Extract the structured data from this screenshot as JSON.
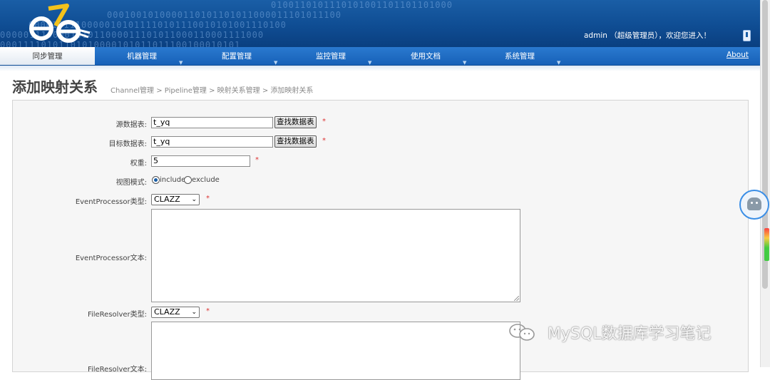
{
  "header": {
    "user_text": "admin （超级管理员），欢迎您进入！"
  },
  "nav": {
    "items": [
      {
        "label": "同步管理",
        "active": true
      },
      {
        "label": "机器管理"
      },
      {
        "label": "配置管理"
      },
      {
        "label": "监控管理"
      },
      {
        "label": "使用文档"
      },
      {
        "label": "系统管理"
      }
    ],
    "about": "About",
    "arrow": "▼"
  },
  "page": {
    "title": "添加映射关系",
    "breadcrumb": "Channel管理  >  Pipeline管理  >  映射关系管理  >  添加映射关系"
  },
  "form": {
    "source_label": "源数据表:",
    "source_value": "t_yq",
    "find_button": "查找数据表",
    "target_label": "目标数据表:",
    "target_value": "t_yq",
    "weight_label": "权重:",
    "weight_value": "5",
    "view_mode_label": "视图模式:",
    "include_label": "include",
    "exclude_label": "exclude",
    "event_type_label": "EventProcessor类型:",
    "event_type_value": "CLAZZ",
    "event_text_label": "EventProcessor文本:",
    "file_type_label": "FileResolver类型:",
    "file_type_value": "CLAZZ",
    "file_text_label": "FileResolver文本:",
    "required_mark": "*"
  },
  "watermark": {
    "text": "MySQL数据库学习笔记"
  }
}
